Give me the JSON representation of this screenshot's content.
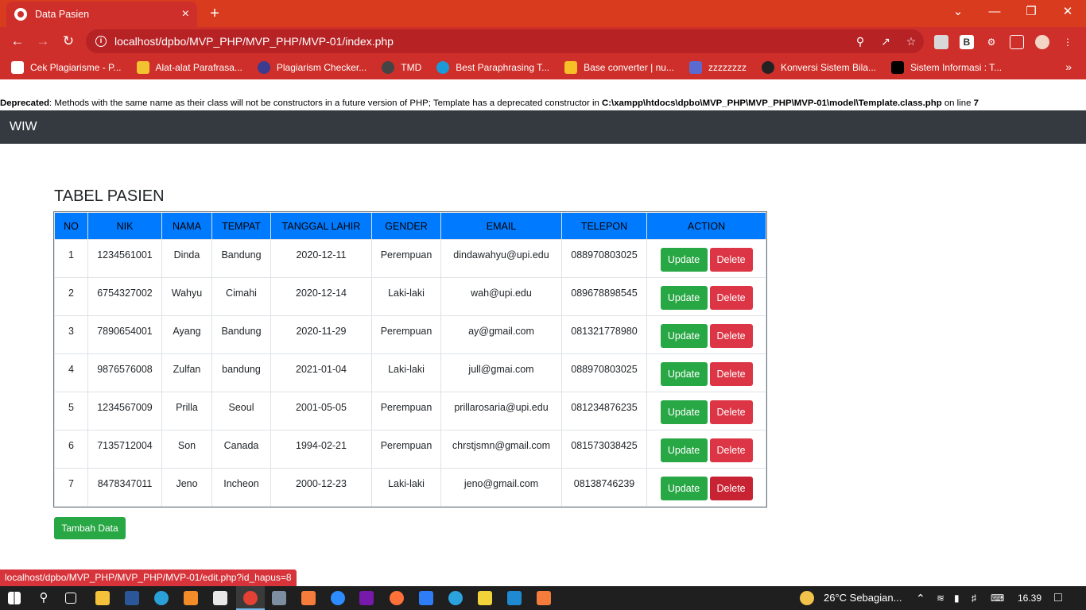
{
  "browser": {
    "tab_title": "Data Pasien",
    "tab_close": "×",
    "new_tab": "+",
    "url": "localhost/dpbo/MVP_PHP/MVP_PHP/MVP-01/index.php",
    "window_controls": [
      "⌄",
      "—",
      "❐",
      "✕"
    ],
    "bookmarks": [
      {
        "label": "Cek Plagiarisme - P...",
        "icon_color": "#ffffff"
      },
      {
        "label": "Alat-alat Parafrasa...",
        "icon_color": "#f2c230"
      },
      {
        "label": "Plagiarism Checker...",
        "icon_color": "#3b3b8f"
      },
      {
        "label": "TMD",
        "icon_color": "#444444"
      },
      {
        "label": "Best Paraphrasing T...",
        "icon_color": "#1a9ad6"
      },
      {
        "label": "Base converter | nu...",
        "icon_color": "#f6c026"
      },
      {
        "label": "zzzzzzzz",
        "icon_color": "#5b6ad0"
      },
      {
        "label": "Konversi Sistem Bila...",
        "icon_color": "#222222"
      },
      {
        "label": "Sistem Informasi : T...",
        "icon_color": "#000000"
      }
    ]
  },
  "page": {
    "deprecated_label": "Deprecated",
    "deprecated_text": ": Methods with the same name as their class will not be constructors in a future version of PHP; Template has a deprecated constructor in ",
    "deprecated_path": "C:\\xampp\\htdocs\\dpbo\\MVP_PHP\\MVP_PHP\\MVP-01\\model\\Template.class.php",
    "deprecated_online": " on line ",
    "deprecated_line": "7",
    "brand": "WIW",
    "heading": "TABEL PASIEN",
    "columns": [
      "NO",
      "NIK",
      "NAMA",
      "TEMPAT",
      "TANGGAL LAHIR",
      "GENDER",
      "EMAIL",
      "TELEPON",
      "ACTION"
    ],
    "rows": [
      [
        "1",
        "1234561001",
        "Dinda",
        "Bandung",
        "2020-12-11",
        "Perempuan",
        "dindawahyu@upi.edu",
        "088970803025"
      ],
      [
        "2",
        "6754327002",
        "Wahyu",
        "Cimahi",
        "2020-12-14",
        "Laki-laki",
        "wah@upi.edu",
        "089678898545"
      ],
      [
        "3",
        "7890654001",
        "Ayang",
        "Bandung",
        "2020-11-29",
        "Perempuan",
        "ay@gmail.com",
        "081321778980"
      ],
      [
        "4",
        "9876576008",
        "Zulfan",
        "bandung",
        "2021-01-04",
        "Laki-laki",
        "jull@gmai.com",
        "088970803025"
      ],
      [
        "5",
        "1234567009",
        "Prilla",
        "Seoul",
        "2001-05-05",
        "Perempuan",
        "prillarosaria@upi.edu",
        "081234876235"
      ],
      [
        "6",
        "7135712004",
        "Son",
        "Canada",
        "1994-02-21",
        "Perempuan",
        "chrstjsmn@gmail.com",
        "081573038425"
      ],
      [
        "7",
        "8478347011",
        "Jeno",
        "Incheon",
        "2000-12-23",
        "Laki-laki",
        "jeno@gmail.com",
        "08138746239"
      ]
    ],
    "update_label": "Update",
    "delete_label": "Delete",
    "add_label": "Tambah Data",
    "status_url": "localhost/dpbo/MVP_PHP/MVP_PHP/MVP-01/edit.php?id_hapus=8"
  },
  "taskbar": {
    "weather": "26°C  Sebagian...",
    "time": "16.39"
  },
  "colors": {
    "accent": "#d83b1e",
    "table_header": "#007bff",
    "update": "#28a745",
    "delete": "#dc3545",
    "navbar": "#343a40"
  }
}
